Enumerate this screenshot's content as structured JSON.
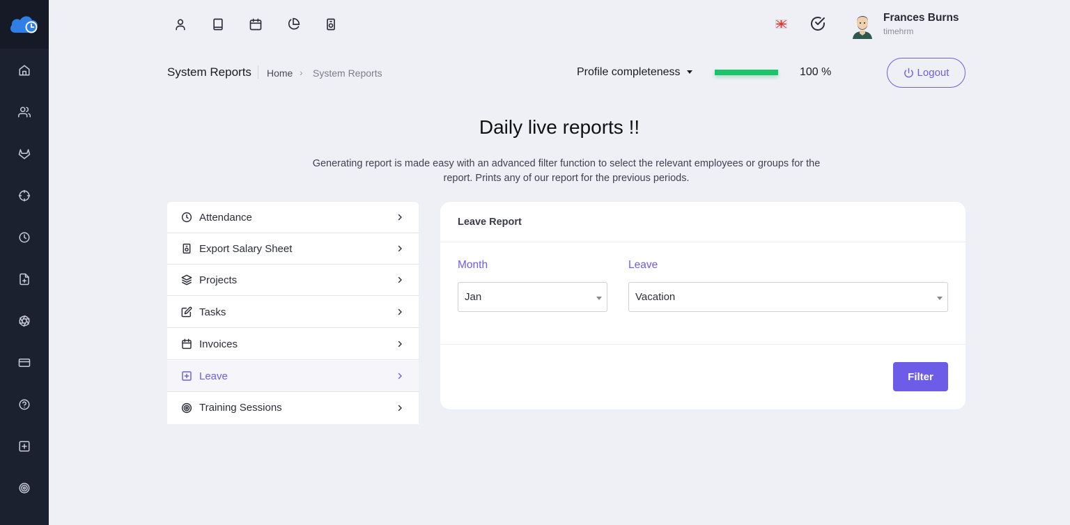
{
  "header": {
    "user_name": "Frances Burns",
    "user_subtitle": "timehrm",
    "top_icons": [
      "user-icon",
      "book-icon",
      "calendar-icon",
      "pie-chart-icon",
      "safe-icon"
    ]
  },
  "sidebar": {
    "items": [
      "home-icon",
      "users-icon",
      "gitlab-icon",
      "crosshair-icon",
      "clock-icon",
      "file-plus-icon",
      "aperture-icon",
      "credit-card-icon",
      "help-circle-icon",
      "plus-square-icon",
      "target-icon"
    ]
  },
  "breadcrumb": {
    "page_title": "System Reports",
    "home": "Home",
    "separator": "›",
    "current": "System Reports"
  },
  "profile": {
    "label": "Profile completeness",
    "progress_percent": 100,
    "progress_text": "100 %"
  },
  "logout": {
    "label": "Logout"
  },
  "hero": {
    "title": "Daily live reports !!",
    "description": "Generating report is made easy with an advanced filter function to select the relevant employees or groups for the report. Prints any of our report for the previous periods."
  },
  "report_menu": {
    "items": [
      {
        "label": "Attendance",
        "icon": "clock-icon"
      },
      {
        "label": "Export Salary Sheet",
        "icon": "safe-icon"
      },
      {
        "label": "Projects",
        "icon": "layers-icon"
      },
      {
        "label": "Tasks",
        "icon": "edit-icon"
      },
      {
        "label": "Invoices",
        "icon": "calendar-icon"
      },
      {
        "label": "Leave",
        "icon": "plus-square-icon"
      },
      {
        "label": "Training Sessions",
        "icon": "target-icon"
      }
    ],
    "active_index": 5
  },
  "leave_report": {
    "title": "Leave Report",
    "month_label": "Month",
    "month_value": "Jan",
    "leave_label": "Leave",
    "leave_value": "Vacation",
    "filter_label": "Filter"
  },
  "colors": {
    "accent": "#6d5ce8",
    "sidebar_bg": "#1c2130",
    "progress": "#1ec26b",
    "page_bg": "#eff0f6"
  }
}
